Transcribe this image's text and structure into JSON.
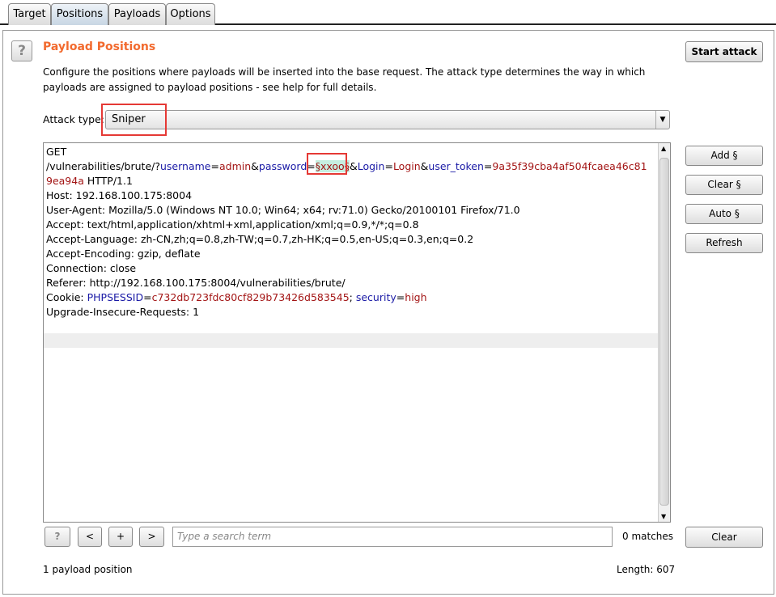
{
  "tabs": [
    {
      "label": "Target"
    },
    {
      "label": "Positions",
      "active": true
    },
    {
      "label": "Payloads"
    },
    {
      "label": "Options"
    }
  ],
  "header": {
    "help_icon": "?",
    "title": "Payload Positions",
    "description": "Configure the positions where payloads will be inserted into the base request. The attack type determines the way in which payloads are assigned to payload positions - see help for full details.",
    "start_attack": "Start attack"
  },
  "attack_type": {
    "label": "Attack type:",
    "value": "Sniper"
  },
  "side_buttons": {
    "add": "Add §",
    "clear": "Clear §",
    "auto": "Auto §",
    "refresh": "Refresh"
  },
  "colors": {
    "title": "#f26a2e",
    "param_name": "#1a1aa6",
    "param_value": "#a31515",
    "payload_marker_bg": "#c6efe0",
    "highlight_box": "#e53935"
  },
  "request": {
    "lines": [
      [
        {
          "t": "GET"
        }
      ],
      [
        {
          "t": "/vulnerabilities/brute/?"
        },
        {
          "t": "username",
          "c": "k"
        },
        {
          "t": "="
        },
        {
          "t": "admin",
          "c": "v"
        },
        {
          "t": "&"
        },
        {
          "t": "password",
          "c": "k"
        },
        {
          "t": "="
        },
        {
          "t": "§xxoo§",
          "c": "m"
        },
        {
          "t": "&"
        },
        {
          "t": "Login",
          "c": "k"
        },
        {
          "t": "="
        },
        {
          "t": "Login",
          "c": "v"
        },
        {
          "t": "&"
        },
        {
          "t": "user_token",
          "c": "k"
        },
        {
          "t": "="
        },
        {
          "t": "9a35f39cba4af504fcaea46c81",
          "c": "v"
        }
      ],
      [
        {
          "t": "9ea94a",
          "c": "v"
        },
        {
          "t": " HTTP/1.1"
        }
      ],
      [
        {
          "t": "Host: 192.168.100.175:8004"
        }
      ],
      [
        {
          "t": "User-Agent: Mozilla/5.0 (Windows NT 10.0; Win64; x64; rv:71.0) Gecko/20100101 Firefox/71.0"
        }
      ],
      [
        {
          "t": "Accept: text/html,application/xhtml+xml,application/xml;q=0.9,*/*;q=0.8"
        }
      ],
      [
        {
          "t": "Accept-Language: zh-CN,zh;q=0.8,zh-TW;q=0.7,zh-HK;q=0.5,en-US;q=0.3,en;q=0.2"
        }
      ],
      [
        {
          "t": "Accept-Encoding: gzip, deflate"
        }
      ],
      [
        {
          "t": "Connection: close"
        }
      ],
      [
        {
          "t": "Referer: http://192.168.100.175:8004/vulnerabilities/brute/"
        }
      ],
      [
        {
          "t": "Cookie: "
        },
        {
          "t": "PHPSESSID",
          "c": "k"
        },
        {
          "t": "="
        },
        {
          "t": "c732db723fdc80cf829b73426d583545",
          "c": "v"
        },
        {
          "t": "; "
        },
        {
          "t": "security",
          "c": "k"
        },
        {
          "t": "="
        },
        {
          "t": "high",
          "c": "v"
        }
      ],
      [
        {
          "t": "Upgrade-Insecure-Requests: 1"
        }
      ]
    ]
  },
  "search": {
    "help": "?",
    "prev": "<",
    "add": "+",
    "next": ">",
    "placeholder": "Type a search term",
    "matches": "0 matches",
    "clear": "Clear"
  },
  "footer": {
    "positions": "1 payload position",
    "length": "Length: 607"
  }
}
